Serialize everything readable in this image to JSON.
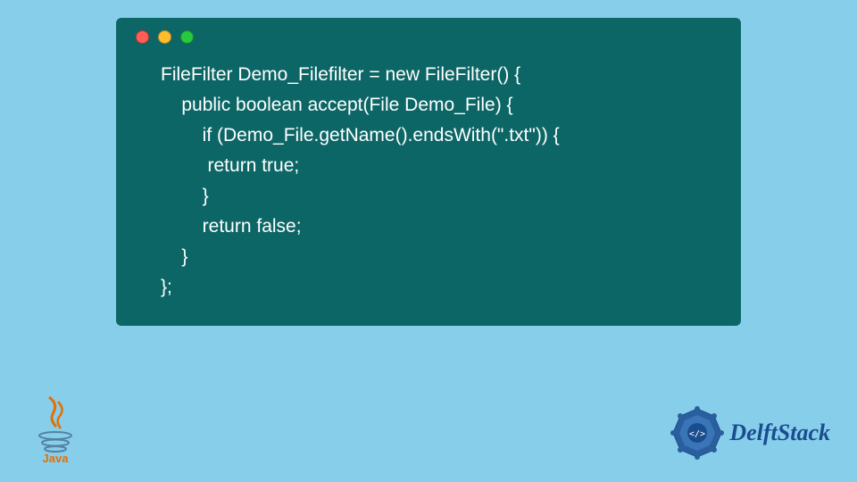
{
  "code": {
    "line1": "FileFilter Demo_Filefilter = new FileFilter() {",
    "line2": "    public boolean accept(File Demo_File) {",
    "line3": "        if (Demo_File.getName().endsWith(\".txt\")) {",
    "line4": "         return true;",
    "line5": "        }",
    "line6": "        return false;",
    "line7": "    }",
    "line8": "};"
  },
  "logos": {
    "java_label": "Java",
    "delftstack_label": "DelftStack"
  },
  "window_controls": {
    "close": "close",
    "minimize": "minimize",
    "maximize": "maximize"
  },
  "colors": {
    "page_bg": "#87ceeb",
    "code_bg": "#0d6666",
    "code_text": "#ffffff",
    "dot_red": "#ff5f56",
    "dot_yellow": "#ffbd2e",
    "dot_green": "#27c93f",
    "delft_blue": "#1a4d8f"
  }
}
